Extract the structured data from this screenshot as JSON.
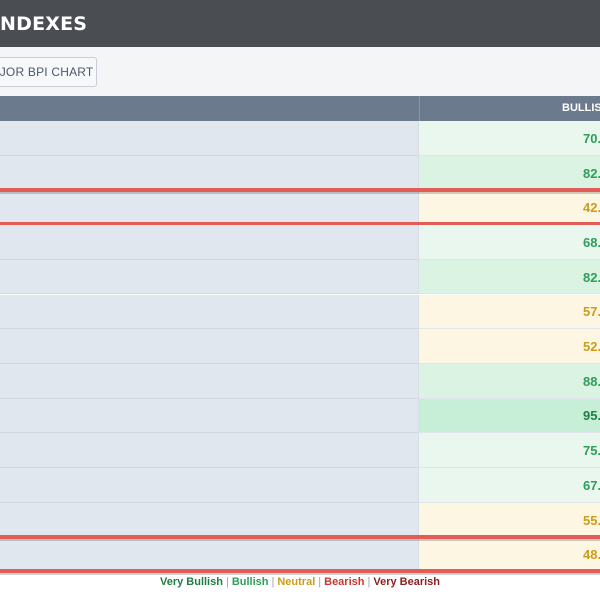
{
  "header": {
    "title": "NDEXES"
  },
  "toolbar": {
    "chart_button_label": "AJOR BPI CHART"
  },
  "table": {
    "column_header": "BULLISH",
    "rows": [
      {
        "value": "70.",
        "sentiment": "bullish"
      },
      {
        "value": "82.",
        "sentiment": "bullish"
      },
      {
        "value": "42.",
        "sentiment": "neutral",
        "selected": true
      },
      {
        "value": "68.",
        "sentiment": "bullish"
      },
      {
        "value": "82.",
        "sentiment": "bullish"
      },
      {
        "value": "57.",
        "sentiment": "neutral"
      },
      {
        "value": "52.",
        "sentiment": "neutral"
      },
      {
        "value": "88.",
        "sentiment": "bullish"
      },
      {
        "value": "95.",
        "sentiment": "very-bullish"
      },
      {
        "value": "75.",
        "sentiment": "bullish"
      },
      {
        "value": "67.",
        "sentiment": "bullish"
      },
      {
        "value": "55.",
        "sentiment": "neutral"
      },
      {
        "value": "48.",
        "sentiment": "neutral",
        "selected": true
      }
    ]
  },
  "legend": {
    "very_bullish": "Very Bullish",
    "bullish": "Bullish",
    "neutral": "Neutral",
    "bearish": "Bearish",
    "very_bearish": "Very Bearish",
    "separator": "|"
  },
  "colors": {
    "header_bg": "#4a4d52",
    "table_header_bg": "#6b7a8c",
    "highlight": "#e25c58",
    "very_bullish": "#1d7f43",
    "bullish": "#2e9e58",
    "neutral": "#cc9d1a",
    "bearish": "#c6382f",
    "very_bearish": "#8b1f1f"
  }
}
